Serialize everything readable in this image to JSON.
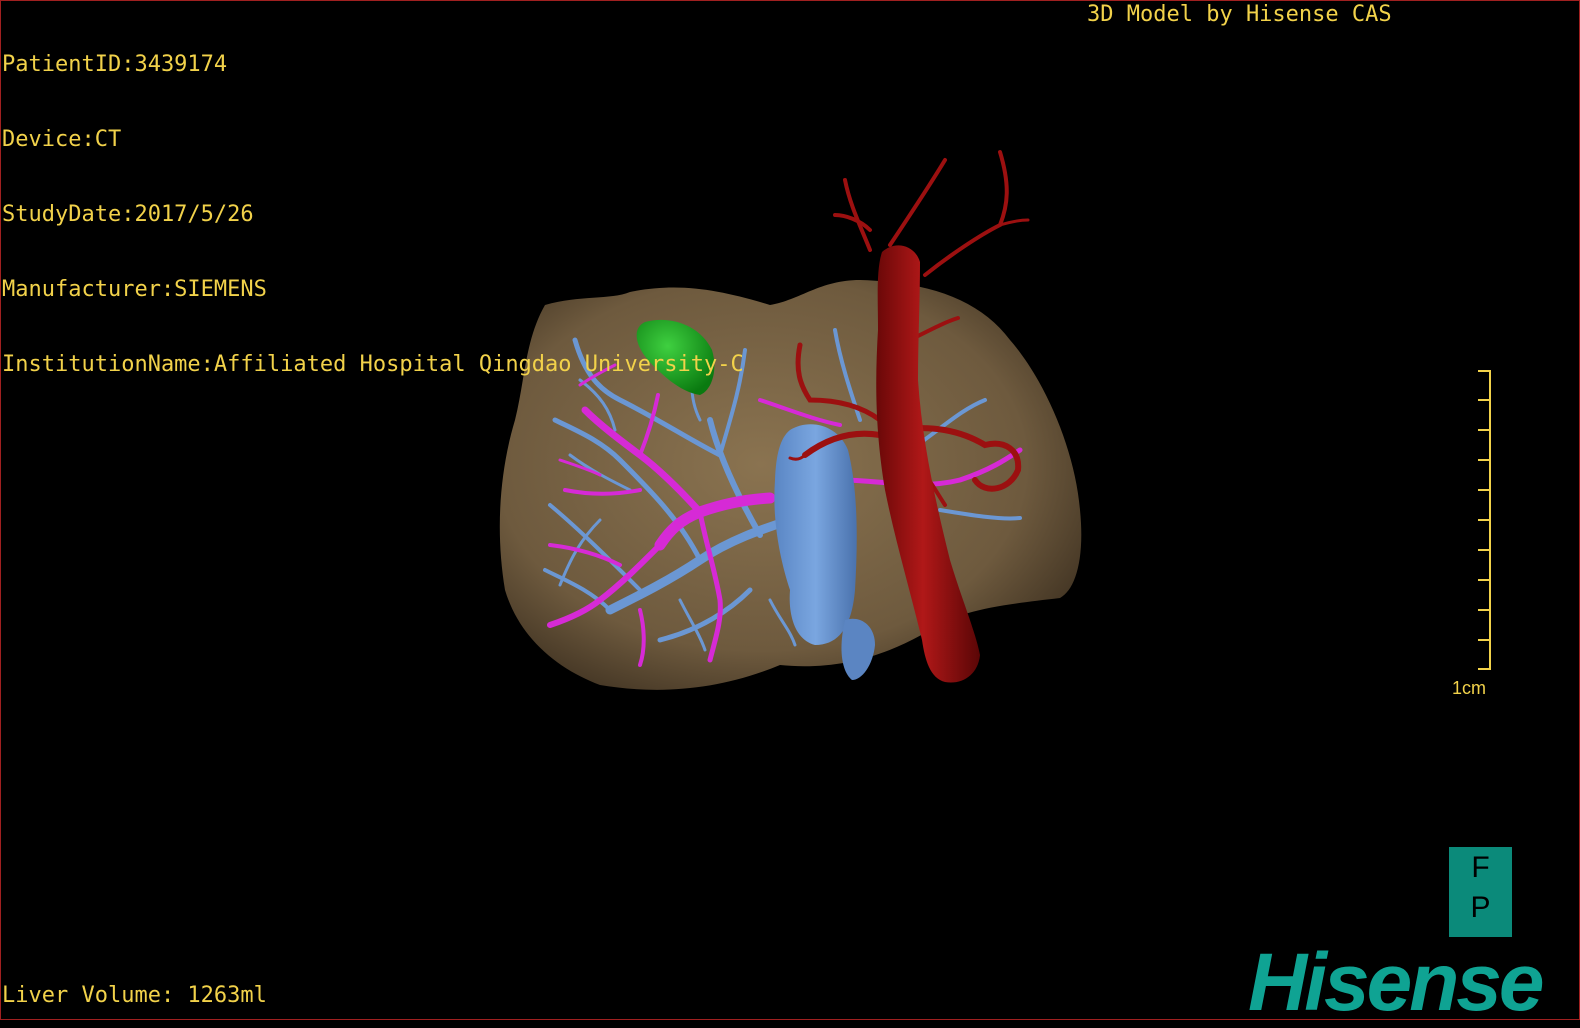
{
  "header": {
    "patient_id": "PatientID:3439174",
    "device": "Device:CT",
    "study_date": "StudyDate:2017/5/26",
    "manufacturer": "Manufacturer:SIEMENS",
    "institution": "InstitutionName:Affiliated Hospital Qingdao University-C",
    "brand_line": "3D Model by Hisense CAS"
  },
  "footer": {
    "liver_volume": "Liver Volume: 1263ml"
  },
  "scale_bar": {
    "label": "1cm"
  },
  "orientation": {
    "top": "F",
    "bottom": "P"
  },
  "logo": {
    "text": "Hisense"
  },
  "colors": {
    "text": "#f2d24a",
    "liver": "#7a6446",
    "hepatic_vein": "#6b97d3",
    "portal_vein": "#d62ad6",
    "artery": "#9c1010",
    "gallbladder": "#16a81c",
    "logo": "#0fa393"
  }
}
